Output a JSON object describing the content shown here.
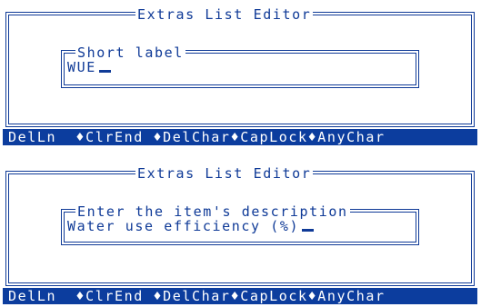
{
  "panels": [
    {
      "title": "Extras List Editor",
      "prompt": "Short label",
      "value": "WUE",
      "keys": [
        "DelLn",
        "ClrEnd",
        "DelChar",
        "CapLock",
        "AnyChar"
      ]
    },
    {
      "title": "Extras List Editor",
      "prompt": "Enter the item's description",
      "value": "Water use efficiency (%)",
      "keys": [
        "DelLn",
        "ClrEnd",
        "DelChar",
        "CapLock",
        "AnyChar"
      ]
    }
  ],
  "key_separator": "♦",
  "colors": {
    "frame": "#0f3a97",
    "function_bar_bg": "#0c3d9e",
    "function_bar_text": "#ffffff",
    "background": "#ffffff"
  }
}
